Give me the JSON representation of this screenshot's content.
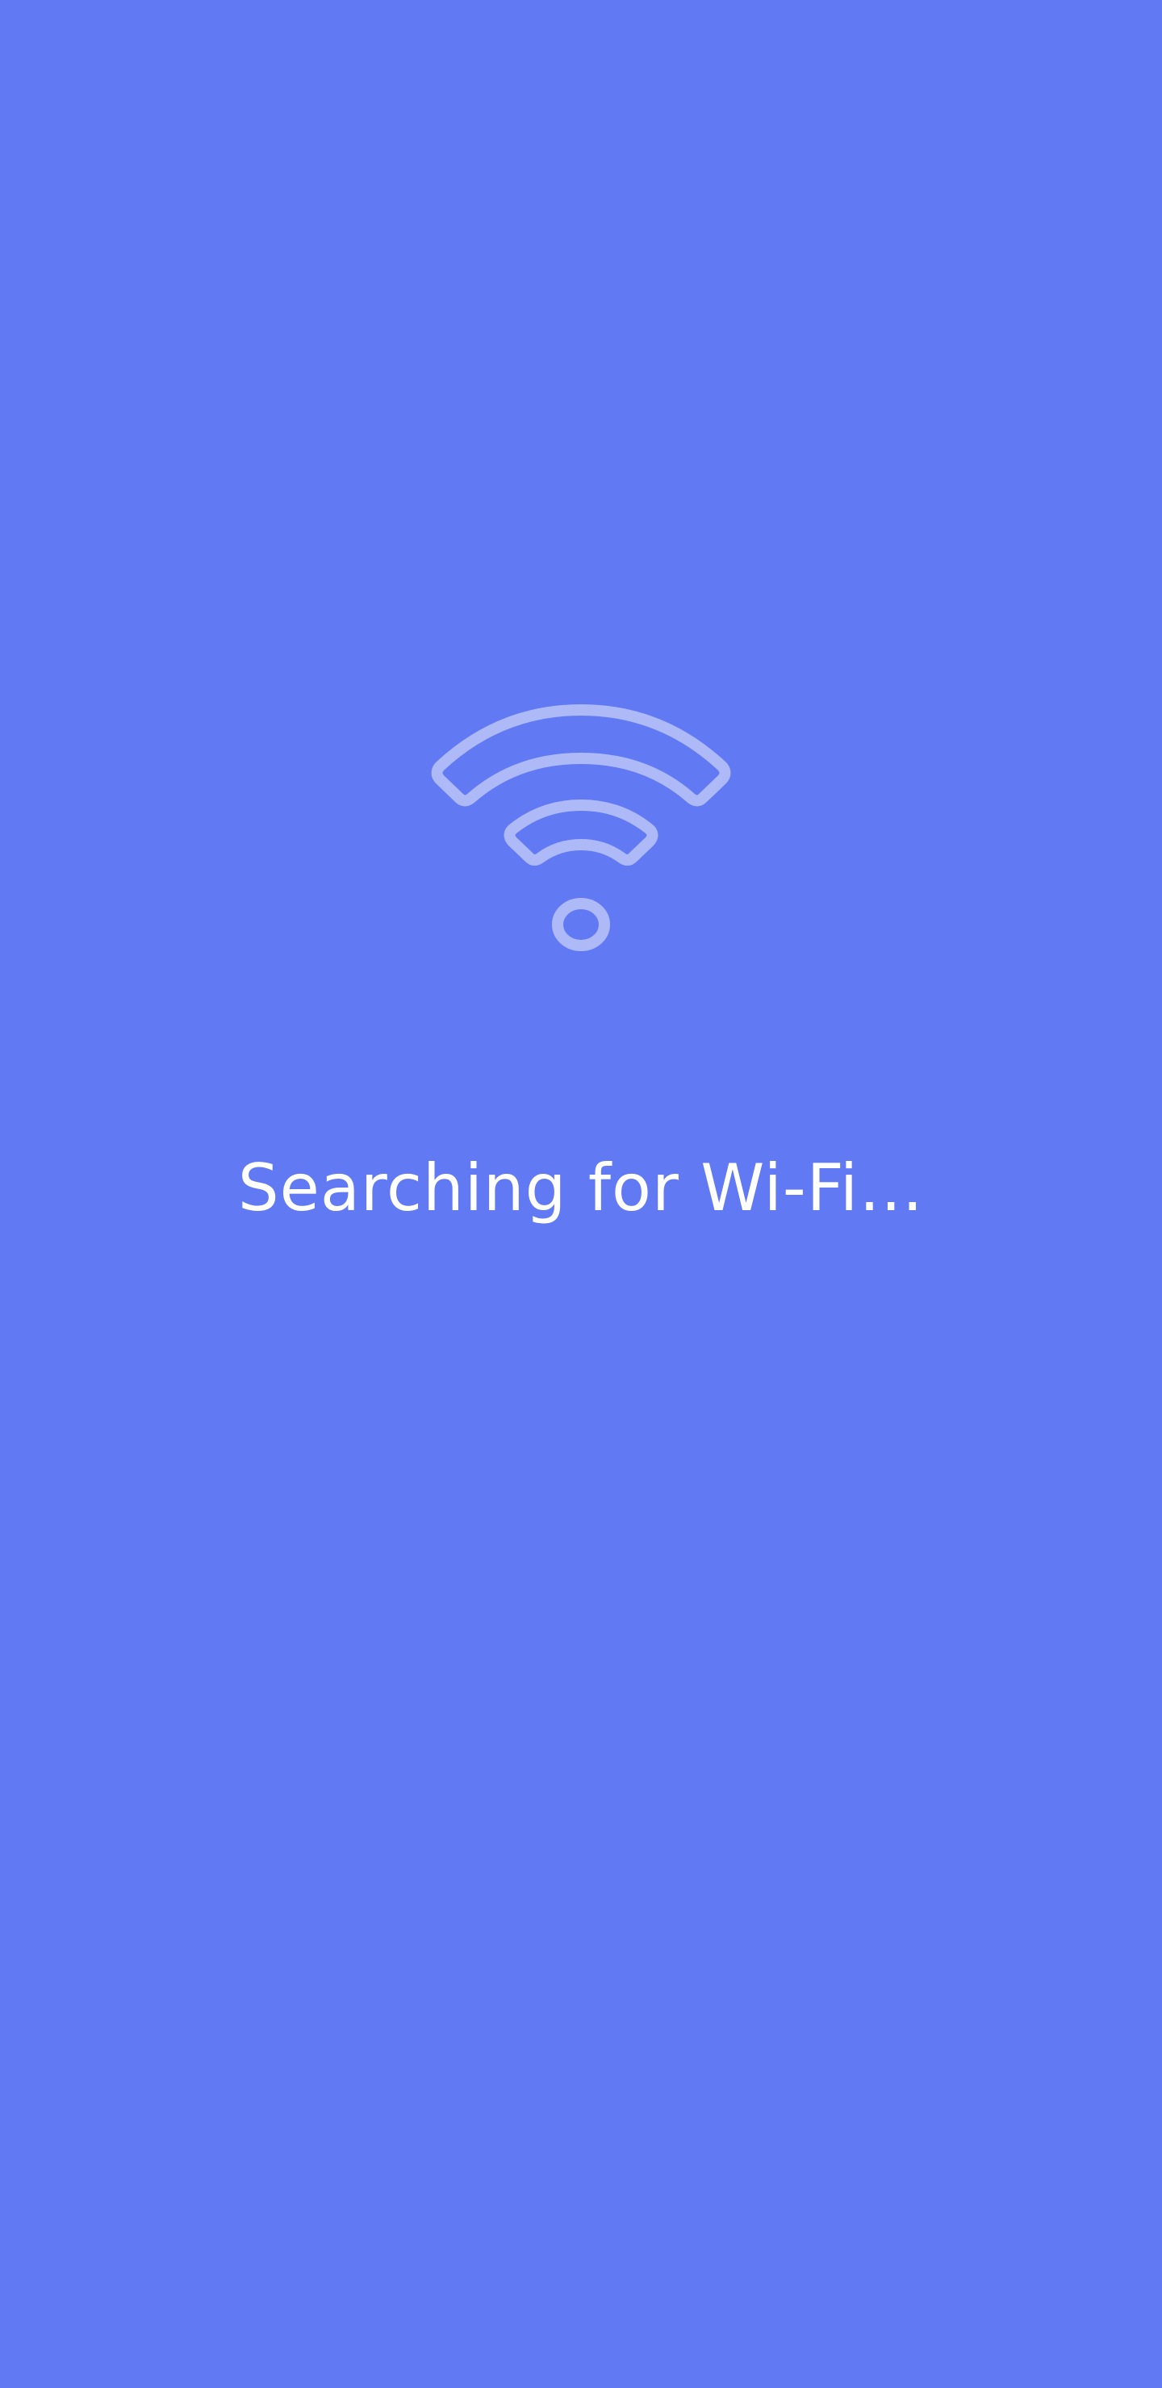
{
  "status": {
    "message": "Searching for Wi-Fi…"
  },
  "icon": {
    "name": "wifi-icon",
    "color": "#AEB9F8"
  },
  "colors": {
    "background": "#6279F4",
    "text": "#FFFFFF"
  }
}
